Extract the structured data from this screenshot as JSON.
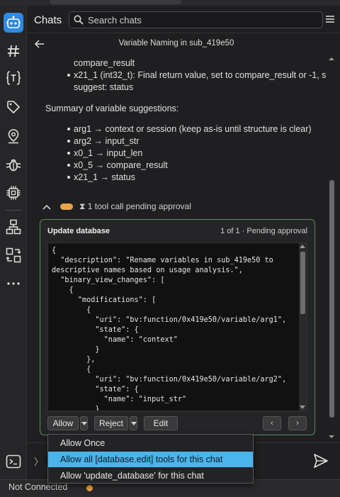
{
  "header": {
    "title": "Chats",
    "search_placeholder": "Search chats"
  },
  "conversation": {
    "title": "Variable Naming in sub_419e50"
  },
  "message": {
    "lines": [
      "compare_result",
      "x21_1 (int32_t): Final return value, set to compare_result or -1, so",
      "suggest: status"
    ],
    "summary_heading": "Summary of variable suggestions:",
    "suggestions": [
      "arg1 → context or session (keep as-is until structure is clear)",
      "arg2 → input_str",
      "x0_1 → input_len",
      "x0_5 → compare_result",
      "x21_1 → status"
    ]
  },
  "tool_call": {
    "pending_text": "⧗ 1 tool call pending approval",
    "card_title": "Update database",
    "card_status": "1 of 1 · Pending approval",
    "code": "{\n  \"description\": \"Rename variables in sub_419e50 to\ndescriptive names based on usage analysis.\",\n  \"binary_view_changes\": [\n    {\n      \"modifications\": [\n        {\n          \"uri\": \"bv:function/0x419e50/variable/arg1\",\n          \"state\": {\n            \"name\": \"context\"\n          }\n        },\n        {\n          \"uri\": \"bv:function/0x419e50/variable/arg2\",\n          \"state\": {\n            \"name\": \"input_str\"\n          }",
    "allow_label": "Allow",
    "reject_label": "Reject",
    "edit_label": "Edit",
    "prev_label": "‹",
    "next_label": "›"
  },
  "allow_menu": {
    "items": [
      "Allow Once",
      "Allow all [database.edit] tools for this chat",
      "Allow 'update_database' for this chat"
    ],
    "selected_index": 1
  },
  "input": {
    "expand_label": "〉"
  },
  "status": {
    "connection": "Not Connected"
  },
  "colors": {
    "accent": "#2f8ae0",
    "pending": "#e8a54b",
    "card_border": "#5a8b5a",
    "menu_selected": "#4bb4ea"
  },
  "icons": [
    "robot-icon",
    "hash-icon",
    "type-braces-icon",
    "tag-icon",
    "location-pin-icon",
    "bug-icon",
    "chip-icon",
    "hierarchy-icon",
    "swap-icon",
    "more-icon",
    "terminal-icon",
    "search-icon",
    "menu-icon",
    "back-arrow-icon",
    "send-icon"
  ]
}
